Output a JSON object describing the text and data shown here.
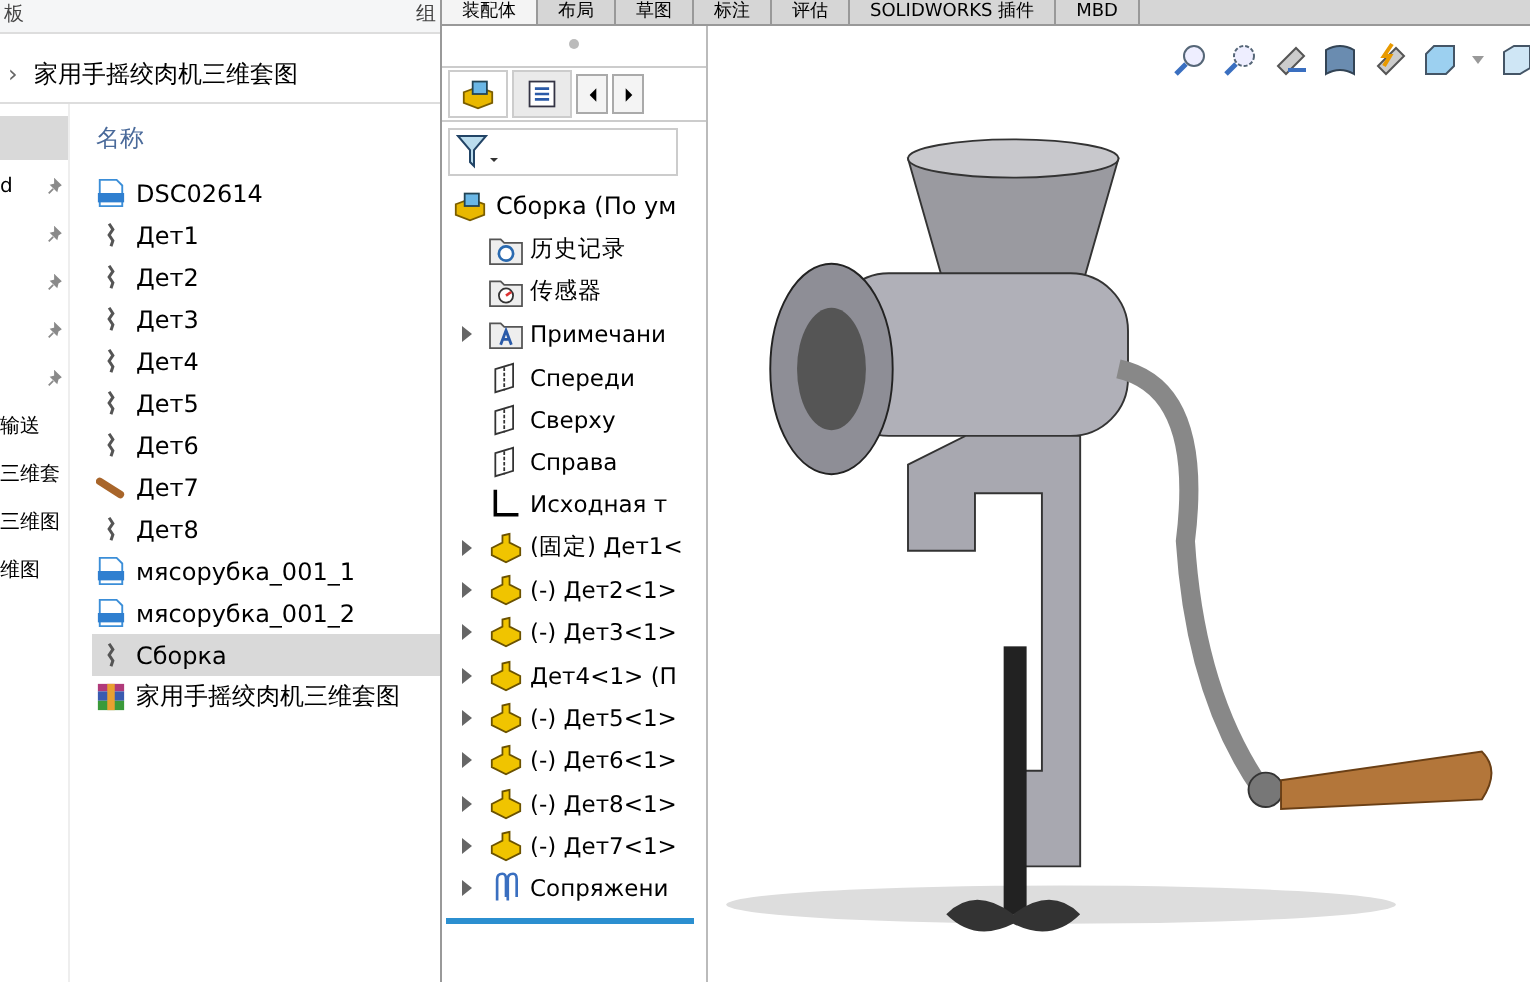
{
  "explorer": {
    "ribbon_labels": [
      "板",
      "组"
    ],
    "breadcrumb": {
      "separator": "›",
      "folder": "家用手摇绞肉机三维套图"
    },
    "nav_items": [
      {
        "selected": true,
        "pinned": false
      },
      {
        "label": "d",
        "selected": false,
        "pinned": true
      },
      {
        "selected": false,
        "pinned": true
      },
      {
        "selected": false,
        "pinned": true
      },
      {
        "selected": false,
        "pinned": true
      },
      {
        "selected": false,
        "pinned": true
      },
      {
        "label": "输送",
        "selected": false,
        "pinned": false
      },
      {
        "label": "三维套",
        "selected": false,
        "pinned": false
      },
      {
        "label": "三维图",
        "selected": false,
        "pinned": false
      },
      {
        "label": "维图",
        "selected": false,
        "pinned": false
      }
    ],
    "column_header": "名称",
    "files": [
      {
        "name": "DSC02614",
        "kind": "jpg",
        "selected": false
      },
      {
        "name": "Дет1",
        "kind": "part",
        "selected": false
      },
      {
        "name": "Дет2",
        "kind": "part",
        "selected": false
      },
      {
        "name": "Дет3",
        "kind": "part",
        "selected": false
      },
      {
        "name": "Дет4",
        "kind": "part",
        "selected": false
      },
      {
        "name": "Дет5",
        "kind": "part",
        "selected": false
      },
      {
        "name": "Дет6",
        "kind": "part",
        "selected": false
      },
      {
        "name": "Дет7",
        "kind": "wood",
        "selected": false
      },
      {
        "name": "Дет8",
        "kind": "part",
        "selected": false
      },
      {
        "name": "мясорубка_001_1",
        "kind": "jpg",
        "selected": false
      },
      {
        "name": "мясорубка_001_2",
        "kind": "jpg",
        "selected": false
      },
      {
        "name": "Сборка",
        "kind": "part",
        "selected": true
      },
      {
        "name": "家用手摇绞肉机三维套图",
        "kind": "archive",
        "selected": false
      }
    ]
  },
  "solidworks": {
    "tabs": [
      {
        "label": "装配体",
        "selected": true
      },
      {
        "label": "布局",
        "selected": false
      },
      {
        "label": "草图",
        "selected": false
      },
      {
        "label": "标注",
        "selected": false
      },
      {
        "label": "评估",
        "selected": false
      },
      {
        "label": "SOLIDWORKS 插件",
        "selected": false
      },
      {
        "label": "MBD",
        "selected": false
      }
    ],
    "tree_root": "Сборка  (По ум",
    "tree": [
      {
        "label": "历史记录",
        "kind": "history",
        "expandable": false
      },
      {
        "label": "传感器",
        "kind": "sensor",
        "expandable": false
      },
      {
        "label": "Примечани",
        "kind": "annotation",
        "expandable": true
      },
      {
        "label": "Спереди",
        "kind": "plane",
        "expandable": false
      },
      {
        "label": "Сверху",
        "kind": "plane",
        "expandable": false
      },
      {
        "label": "Справа",
        "kind": "plane",
        "expandable": false
      },
      {
        "label": "Исходная т",
        "kind": "origin",
        "expandable": false
      },
      {
        "label": "(固定) Дет1<",
        "kind": "part",
        "expandable": true
      },
      {
        "label": "(-) Дет2<1>",
        "kind": "part",
        "expandable": true
      },
      {
        "label": "(-) Дет3<1>",
        "kind": "part",
        "expandable": true
      },
      {
        "label": "Дет4<1> (П",
        "kind": "part",
        "expandable": true
      },
      {
        "label": "(-) Дет5<1>",
        "kind": "part",
        "expandable": true
      },
      {
        "label": "(-) Дет6<1>",
        "kind": "part",
        "expandable": true
      },
      {
        "label": "(-) Дет8<1>",
        "kind": "part",
        "expandable": true
      },
      {
        "label": "(-) Дет7<1>",
        "kind": "part",
        "expandable": true
      },
      {
        "label": "Сопряжени",
        "kind": "mate",
        "expandable": true
      }
    ]
  }
}
